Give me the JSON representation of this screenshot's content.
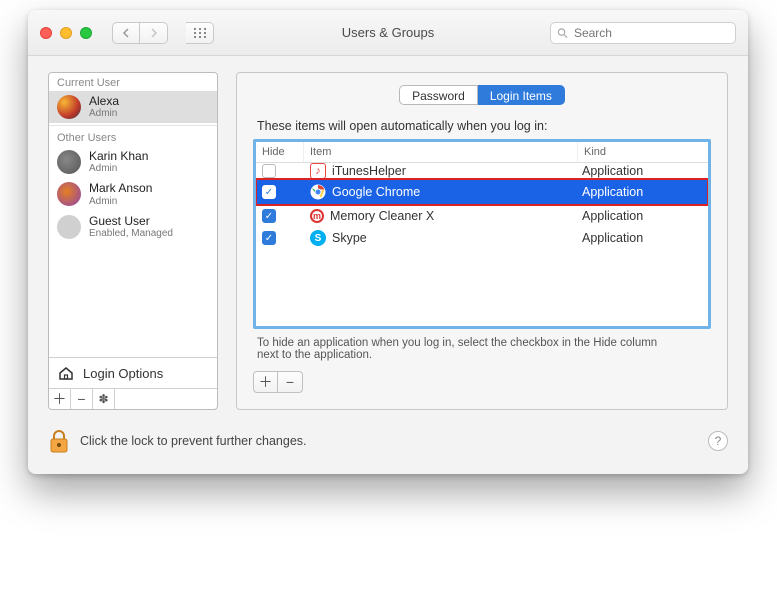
{
  "window": {
    "title": "Users & Groups",
    "search_placeholder": "Search"
  },
  "sidebar": {
    "sections": {
      "current": "Current User",
      "other": "Other Users"
    },
    "current_user": {
      "name": "Alexa",
      "role": "Admin"
    },
    "other_users": [
      {
        "name": "Karin Khan",
        "role": "Admin"
      },
      {
        "name": "Mark Anson",
        "role": "Admin"
      },
      {
        "name": "Guest User",
        "role": "Enabled, Managed"
      }
    ],
    "login_options_label": "Login Options"
  },
  "tabs": {
    "password": "Password",
    "login_items": "Login Items",
    "active": "login_items"
  },
  "login_items": {
    "instruction": "These items will open automatically when you log in:",
    "columns": {
      "hide": "Hide",
      "item": "Item",
      "kind": "Kind"
    },
    "rows": [
      {
        "hide": false,
        "name": "iTunesHelper",
        "kind": "Application",
        "icon": "itunes",
        "selected": false,
        "highlight": false
      },
      {
        "hide": true,
        "name": "Google Chrome",
        "kind": "Application",
        "icon": "chrome",
        "selected": true,
        "highlight": true
      },
      {
        "hide": true,
        "name": "Memory Cleaner X",
        "kind": "Application",
        "icon": "memory",
        "selected": false,
        "highlight": false
      },
      {
        "hide": true,
        "name": "Skype",
        "kind": "Application",
        "icon": "skype",
        "selected": false,
        "highlight": false
      }
    ],
    "hint": "To hide an application when you log in, select the checkbox in the Hide column next to the application."
  },
  "footer": {
    "lock_text": "Click the lock to prevent further changes."
  }
}
